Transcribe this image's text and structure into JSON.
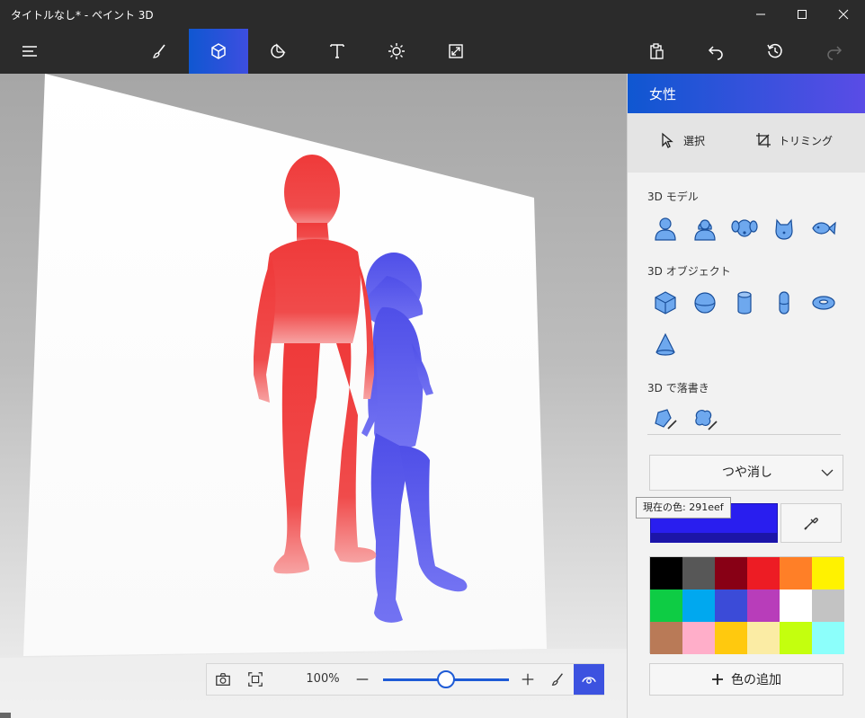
{
  "window": {
    "title": "タイトルなし* - ペイント 3D",
    "controls": [
      "minimize-icon",
      "maximize-icon",
      "close-icon"
    ]
  },
  "toolbar": {
    "left": [
      "menu-icon"
    ],
    "tools": [
      {
        "name": "brush-icon",
        "active": false
      },
      {
        "name": "3d-shapes-icon",
        "active": true
      },
      {
        "name": "stickers-icon",
        "active": false
      },
      {
        "name": "text-icon",
        "active": false
      },
      {
        "name": "effects-icon",
        "active": false
      },
      {
        "name": "canvas-icon",
        "active": false
      }
    ],
    "right": [
      "paste-icon",
      "undo-icon",
      "history-icon",
      "redo-icon"
    ]
  },
  "zoom": {
    "value": "100%",
    "level": 0.5,
    "icons": [
      "camera-icon",
      "fit-icon",
      "minus-icon",
      "plus-icon",
      "brush-icon",
      "eye-icon"
    ]
  },
  "panel": {
    "title": "女性",
    "tools": {
      "select": "選択",
      "crop": "トリミング"
    },
    "models_label": "3D モデル",
    "models": [
      "man-icon",
      "woman-icon",
      "dog-icon",
      "cat-icon",
      "fish-icon"
    ],
    "objects_label": "3D オブジェクト",
    "objects": [
      "cube-icon",
      "sphere-icon",
      "cylinder-icon",
      "capsule-icon",
      "donut-icon",
      "cone-icon"
    ],
    "doodle_label": "3D で落書き",
    "doodles": [
      "sharp-doodle-icon",
      "soft-doodle-icon"
    ],
    "finish": "つや消し",
    "current_color_tooltip": "現在の色: 291eef",
    "current_color": "#291eef",
    "palette": [
      "#000000",
      "#575757",
      "#880015",
      "#ed1c24",
      "#ff7f27",
      "#fff200",
      "#0ecc44",
      "#00a8ef",
      "#3b4bd8",
      "#b83dba",
      "#ffffff",
      "#c3c3c3",
      "#b97a57",
      "#ffaec9",
      "#ffc90e",
      "#fbeca4",
      "#c4ff0e",
      "#8cfffb"
    ],
    "add_color": "色の追加"
  },
  "colors": {
    "accent": "#1e5bd6",
    "man": "#ef4444",
    "woman": "#5a5af0"
  }
}
